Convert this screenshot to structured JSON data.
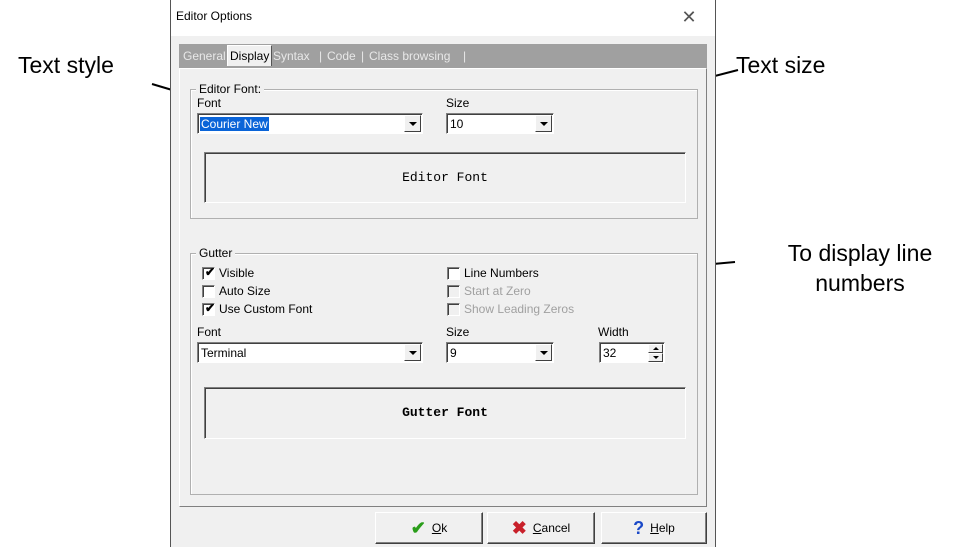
{
  "annotations": {
    "text_style": "Text style",
    "text_size": "Text size",
    "line_numbers_line1": "To display line",
    "line_numbers_line2": "numbers"
  },
  "dialog": {
    "title": "Editor Options",
    "close_glyph": "✕",
    "tabs": [
      "General",
      "Display",
      "Syntax",
      "Code",
      "Class browsing"
    ],
    "tab_separator": "|",
    "selected_tab": "Display",
    "editor_font": {
      "group_label": "Editor Font:",
      "font_label": "Font",
      "font_value": "Courier New",
      "size_label": "Size",
      "size_value": "10",
      "preview_text": "Editor Font"
    },
    "gutter": {
      "group_label": "Gutter",
      "visible_label": "Visible",
      "visible_checked": true,
      "auto_size_label": "Auto Size",
      "auto_size_checked": false,
      "custom_font_label": "Use Custom Font",
      "custom_font_checked": true,
      "line_numbers_label": "Line Numbers",
      "line_numbers_checked": false,
      "start_zero_label": "Start at Zero",
      "leading_zeros_label": "Show Leading Zeros",
      "font_label": "Font",
      "font_value": "Terminal",
      "size_label": "Size",
      "size_value": "9",
      "width_label": "Width",
      "width_value": "32",
      "preview_text": "Gutter Font"
    },
    "buttons": {
      "ok_label": "Ok",
      "ok_key": "O",
      "cancel_label": "Cancel",
      "cancel_key": "C",
      "help_label": "Help",
      "help_key": "H"
    },
    "colors": {
      "selection": "#0a64d8",
      "ok_icon": "#2a9d1a",
      "cancel_icon": "#c8202a",
      "help_icon": "#1a49c8"
    }
  }
}
